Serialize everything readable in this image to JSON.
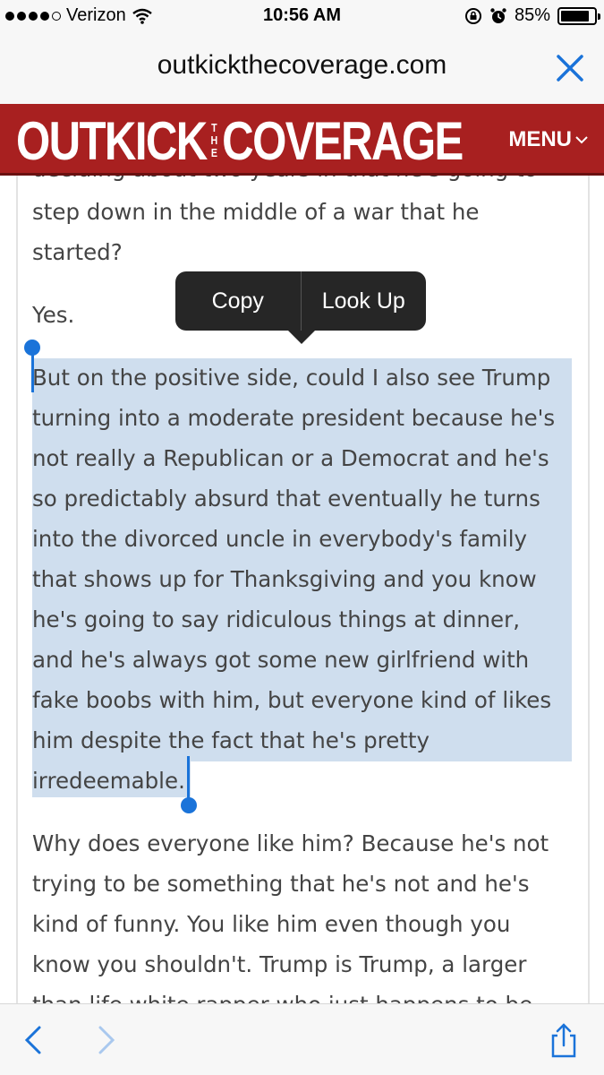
{
  "status_bar": {
    "carrier": "Verizon",
    "time": "10:56 AM",
    "battery_percent": "85%",
    "battery_level": 0.85
  },
  "url_bar": {
    "domain": "outkickthecoverage.com"
  },
  "site_header": {
    "logo_left": "OUTKICK",
    "logo_the": [
      "T",
      "H",
      "E"
    ],
    "logo_right": "COVERAGE",
    "menu_label": "MENU",
    "brand_color": "#a82020"
  },
  "article": {
    "para_top_partial": "deciding about two years in that he's going to",
    "para1_lines": [
      "step down in the middle of a war that he",
      "started?"
    ],
    "para2": "Yes.",
    "para3_lines": [
      "But on the positive side, could I also see Trump",
      "turning into a moderate president because he's",
      "not really a Republican or a Democrat and he's",
      "so predictably absurd that eventually he turns",
      "into the divorced uncle in everybody's family",
      "that shows up for Thanksgiving and you know",
      "he's going to say ridiculous things at dinner,",
      "and he's always got some new girlfriend with",
      "fake boobs with him, but everyone kind of likes",
      "him despite the fact that he's pretty",
      "irredeemable."
    ],
    "para4_lines": [
      "Why does everyone like him? Because he's not",
      "trying to be something that he's not and he's",
      "kind of funny. You like him even though you",
      "know you shouldn't. Trump is Trump, a larger",
      "than life white rapper who just happens to be"
    ]
  },
  "context_menu": {
    "copy_label": "Copy",
    "lookup_label": "Look Up"
  },
  "icons": {
    "wifi": "wifi-icon",
    "lock_rotation": "orientation-lock-icon",
    "alarm": "alarm-icon",
    "close": "close-icon",
    "back": "chevron-left-icon",
    "forward": "chevron-right-icon",
    "share": "share-icon"
  },
  "colors": {
    "selection": "#cfdeee",
    "ios_blue": "#1a73d9"
  }
}
